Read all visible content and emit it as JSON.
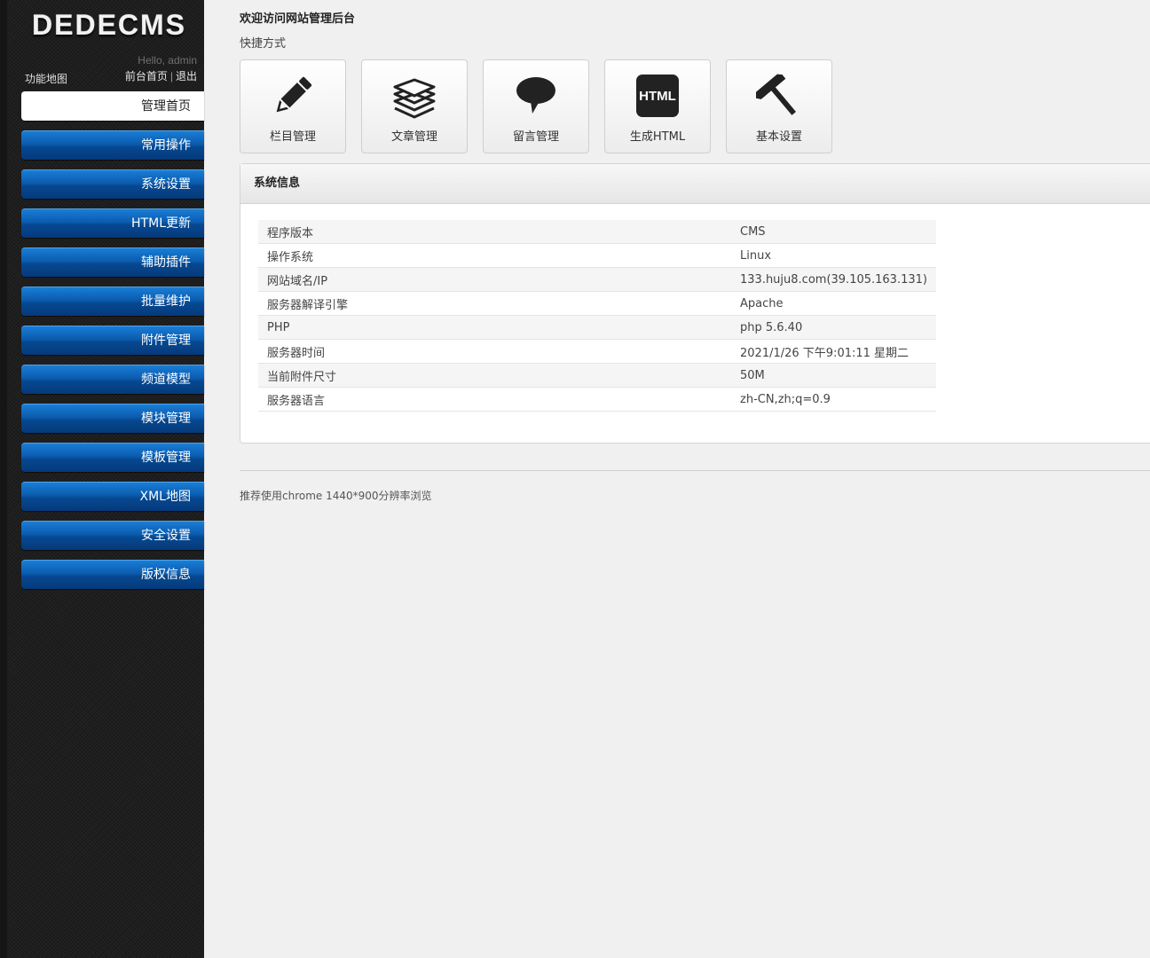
{
  "sidebar": {
    "logo": "DEDECMS",
    "hello": "Hello, admin",
    "front_link": "前台首页",
    "link_sep": "|",
    "logout_link": "退出",
    "map_link": "功能地图",
    "menu": [
      {
        "label": "管理首页",
        "active": true
      },
      {
        "label": "常用操作"
      },
      {
        "label": "系统设置"
      },
      {
        "label": "HTML更新"
      },
      {
        "label": "辅助插件"
      },
      {
        "label": "批量维护"
      },
      {
        "label": "附件管理"
      },
      {
        "label": "频道模型"
      },
      {
        "label": "模块管理"
      },
      {
        "label": "模板管理"
      },
      {
        "label": "XML地图"
      },
      {
        "label": "安全设置"
      },
      {
        "label": "版权信息"
      }
    ]
  },
  "main": {
    "welcome": "欢迎访问网站管理后台",
    "shortcut_title": "快捷方式",
    "shortcuts": [
      {
        "label": "栏目管理",
        "icon": "pencil-icon"
      },
      {
        "label": "文章管理",
        "icon": "stack-icon"
      },
      {
        "label": "留言管理",
        "icon": "speech-bubble-icon"
      },
      {
        "label": "生成HTML",
        "icon": "html-icon",
        "icon_text": "HTML"
      },
      {
        "label": "基本设置",
        "icon": "hammer-icon"
      }
    ],
    "sysinfo": {
      "title": "系统信息",
      "rows": [
        {
          "key": "程序版本",
          "value": "CMS"
        },
        {
          "key": "操作系统",
          "value": "Linux"
        },
        {
          "key": "网站域名/IP",
          "value": "133.huju8.com(39.105.163.131)"
        },
        {
          "key": "服务器解译引擎",
          "value": "Apache"
        },
        {
          "key": "PHP",
          "value": "php 5.6.40"
        },
        {
          "key": "服务器时间",
          "value": "2021/1/26 下午9:01:11 星期二"
        },
        {
          "key": "当前附件尺寸",
          "value": "50M"
        },
        {
          "key": "服务器语言",
          "value": "zh-CN,zh;q=0.9"
        }
      ]
    },
    "footer_note": "推荐使用chrome 1440*900分辨率浏览"
  },
  "colors": {
    "menu_blue": "#0b5cae",
    "sidebar_bg": "#1f1f1f",
    "content_bg": "#f0f0f0"
  }
}
